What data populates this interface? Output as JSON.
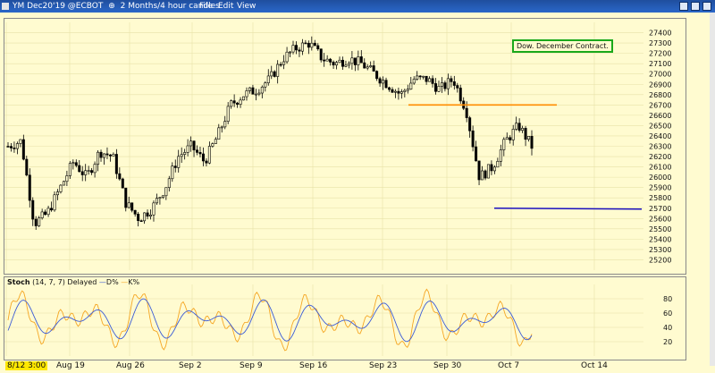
{
  "window": {
    "symbol_title": "YM Dec20'19 @ECBOT",
    "interval": "2 Months/4 hour candles",
    "menu": [
      "File",
      "Edit",
      "View"
    ]
  },
  "annotation": {
    "label": "Dow. December Contract.",
    "color": "#1aa81a"
  },
  "stoch_panel": {
    "label": "Stoch",
    "params": "(14, 7, 7)",
    "mode": "Delayed",
    "d_label": "D%",
    "k_label": "K%",
    "d_color": "#3b5bd6",
    "k_color": "#f5a623"
  },
  "dates": {
    "first_label": "8/12 3:00",
    "ticks": [
      "Aug 19",
      "Aug 26",
      "Sep 2",
      "Sep 9",
      "Sep 16",
      "Sep 23",
      "Sep 30",
      "Oct 7",
      "Oct 14"
    ]
  },
  "chart_data": [
    {
      "type": "candlestick",
      "title": "",
      "x": [
        "Aug 12",
        "Aug 19",
        "Aug 26",
        "Sep 2",
        "Sep 9",
        "Sep 16",
        "Sep 23",
        "Sep 30",
        "Oct 7",
        "Oct 14"
      ],
      "ylim": [
        25100,
        27500
      ],
      "y_ticks": [
        25200,
        25300,
        25400,
        25500,
        25600,
        25700,
        25800,
        25900,
        26000,
        26100,
        26200,
        26300,
        26400,
        26500,
        26600,
        26700,
        26800,
        26900,
        27000,
        27100,
        27200,
        27300,
        27400
      ],
      "grid": true,
      "close_path_approx": [
        {
          "x": "Aug 12",
          "y": 26300
        },
        {
          "x": "Aug 13",
          "y": 26350
        },
        {
          "x": "Aug 14",
          "y": 25550
        },
        {
          "x": "Aug 15",
          "y": 25650
        },
        {
          "x": "Aug 16",
          "y": 25900
        },
        {
          "x": "Aug 19",
          "y": 26150
        },
        {
          "x": "Aug 20",
          "y": 26000
        },
        {
          "x": "Aug 21",
          "y": 26250
        },
        {
          "x": "Aug 22",
          "y": 26200
        },
        {
          "x": "Aug 23",
          "y": 25750
        },
        {
          "x": "Aug 26",
          "y": 25600
        },
        {
          "x": "Aug 27",
          "y": 25700
        },
        {
          "x": "Aug 28",
          "y": 25900
        },
        {
          "x": "Aug 29",
          "y": 26200
        },
        {
          "x": "Aug 30",
          "y": 26300
        },
        {
          "x": "Sep 3",
          "y": 26150
        },
        {
          "x": "Sep 4",
          "y": 26400
        },
        {
          "x": "Sep 5",
          "y": 26700
        },
        {
          "x": "Sep 6",
          "y": 26800
        },
        {
          "x": "Sep 9",
          "y": 26850
        },
        {
          "x": "Sep 10",
          "y": 26950
        },
        {
          "x": "Sep 11",
          "y": 27150
        },
        {
          "x": "Sep 12",
          "y": 27250
        },
        {
          "x": "Sep 13",
          "y": 27300
        },
        {
          "x": "Sep 16",
          "y": 27150
        },
        {
          "x": "Sep 17",
          "y": 27100
        },
        {
          "x": "Sep 18",
          "y": 27150
        },
        {
          "x": "Sep 19",
          "y": 27100
        },
        {
          "x": "Sep 20",
          "y": 27000
        },
        {
          "x": "Sep 23",
          "y": 26900
        },
        {
          "x": "Sep 24",
          "y": 26800
        },
        {
          "x": "Sep 25",
          "y": 26950
        },
        {
          "x": "Sep 26",
          "y": 26950
        },
        {
          "x": "Sep 27",
          "y": 26850
        },
        {
          "x": "Sep 30",
          "y": 26950
        },
        {
          "x": "Oct 1",
          "y": 26650
        },
        {
          "x": "Oct 2",
          "y": 26000
        },
        {
          "x": "Oct 3",
          "y": 26100
        },
        {
          "x": "Oct 4",
          "y": 26350
        },
        {
          "x": "Oct 7",
          "y": 26500
        },
        {
          "x": "Oct 8",
          "y": 26300
        }
      ],
      "horizontal_lines": [
        {
          "y": 26700,
          "color": "#ff8c00",
          "from": "Sep 23",
          "to": "Oct 14"
        },
        {
          "y": 25700,
          "color": "#1a0fbf",
          "from": "Oct 2",
          "to": "Oct 14"
        }
      ],
      "label": "Dow. December Contract."
    },
    {
      "type": "line",
      "title": "Stoch (14, 7, 7) Delayed",
      "ylim": [
        0,
        100
      ],
      "y_ticks": [
        20,
        40,
        60,
        80
      ],
      "series": [
        {
          "name": "D%",
          "color": "#3b5bd6"
        },
        {
          "name": "K%",
          "color": "#f5a623"
        }
      ]
    }
  ]
}
